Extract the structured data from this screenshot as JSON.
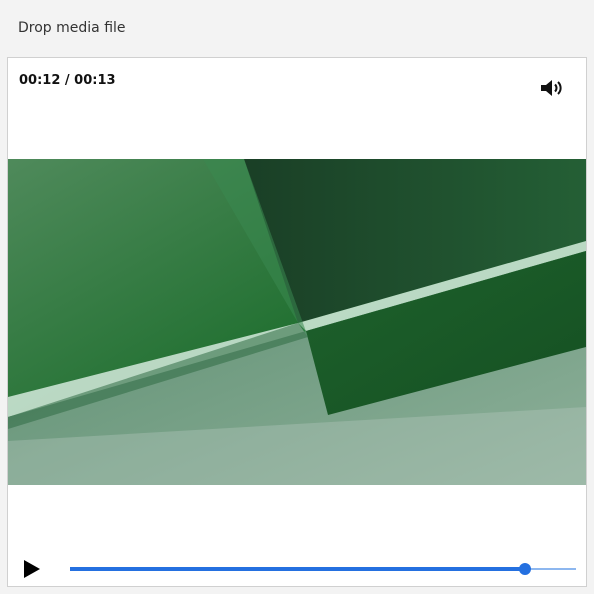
{
  "header": {
    "drop_label": "Drop media file"
  },
  "player": {
    "time_display": "00:12 / 00:13",
    "volume_icon": "speaker-volume-icon",
    "play_icon": "play-icon",
    "progress_fraction": 0.9,
    "accent_color": "#2470e0",
    "track_color": "#8db7ef"
  },
  "video": {
    "dominant_colors": [
      "#1f6b2b",
      "#0f4a20",
      "#78a88a",
      "#a8c7b3"
    ]
  }
}
